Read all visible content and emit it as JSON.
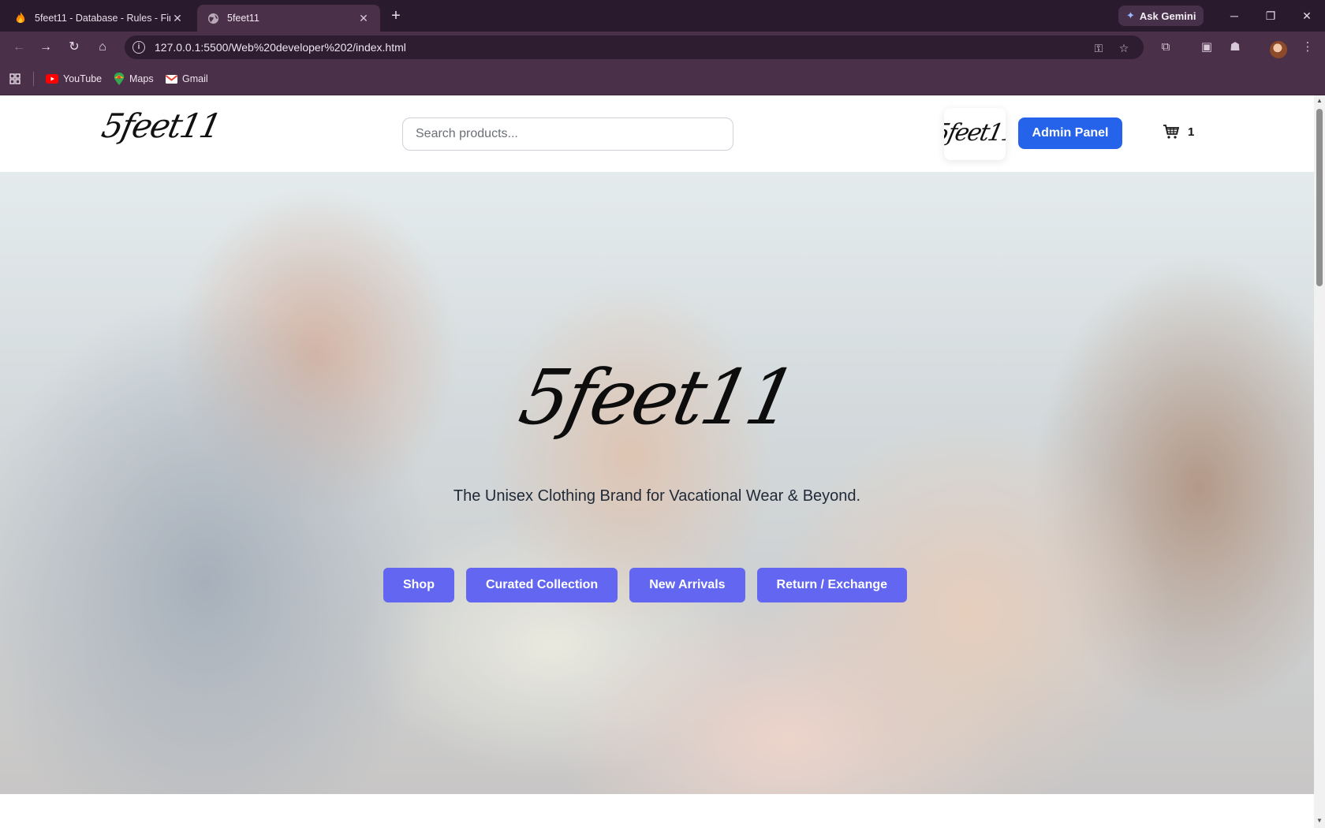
{
  "browser": {
    "tabs": [
      {
        "title": "5feet11 - Database - Rules - Firebase",
        "icon": "firebase-flame-icon",
        "active": false
      },
      {
        "title": "5feet11",
        "icon": "globe-icon",
        "active": true
      }
    ],
    "ask_gemini": "Ask Gemini",
    "url": "127.0.0.1:5500/Web%20developer%202/index.html",
    "bookmarks": [
      {
        "label": "YouTube",
        "icon": "youtube-icon"
      },
      {
        "label": "Maps",
        "icon": "maps-icon"
      },
      {
        "label": "Gmail",
        "icon": "gmail-icon"
      }
    ]
  },
  "site": {
    "logo_text": "5feet11",
    "search_placeholder": "Search products...",
    "admin_button": "Admin Panel",
    "cart_count": "1"
  },
  "hero": {
    "logo_text": "5feet11",
    "tagline": "The Unisex Clothing Brand for Vacational Wear & Beyond.",
    "buttons": [
      "Shop",
      "Curated Collection",
      "New Arrivals",
      "Return / Exchange"
    ]
  },
  "colors": {
    "chrome_dark": "#2a1a2e",
    "chrome_toolbar": "#4a3048",
    "admin_blue": "#2563eb",
    "cta_indigo": "#6366f1"
  }
}
